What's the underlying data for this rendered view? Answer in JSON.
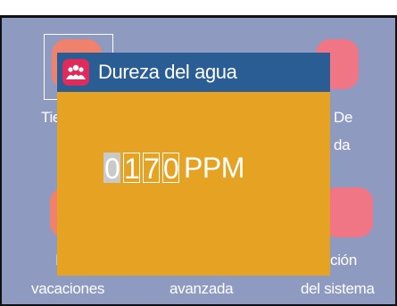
{
  "dialog": {
    "title": "Dureza del agua",
    "icon": "people-icon",
    "digits": [
      "0",
      "1",
      "7",
      "0"
    ],
    "selected_digit_index": 0,
    "unit": "PPM"
  },
  "background_menu": {
    "row1": [
      {
        "label_visible": "Tie",
        "icon": "clock-icon"
      },
      {
        "label_visible": "",
        "icon": "settings-icon"
      },
      {
        "label_visible_line1": "De",
        "label_visible_line2": "da",
        "icon": "water-icon"
      }
    ],
    "row2": [
      {
        "label_visible_line1": "I",
        "label_visible_line2": "vacaciones",
        "icon": "suitcase-icon"
      },
      {
        "label_visible_line2": "avanzada",
        "icon": "advanced-icon"
      },
      {
        "label_visible_line1": "ción",
        "label_visible_line2": "del sistema",
        "icon": "system-icon"
      }
    ]
  },
  "colors": {
    "background": "#8f9ac1",
    "dialog": "#e6a323",
    "dialog_header": "#2a5d93",
    "dialog_icon": "#df2a5c",
    "tile_salmon": "#f0816d",
    "tile_pink": "#f07585",
    "selected_digit": "#c9c9c9"
  }
}
